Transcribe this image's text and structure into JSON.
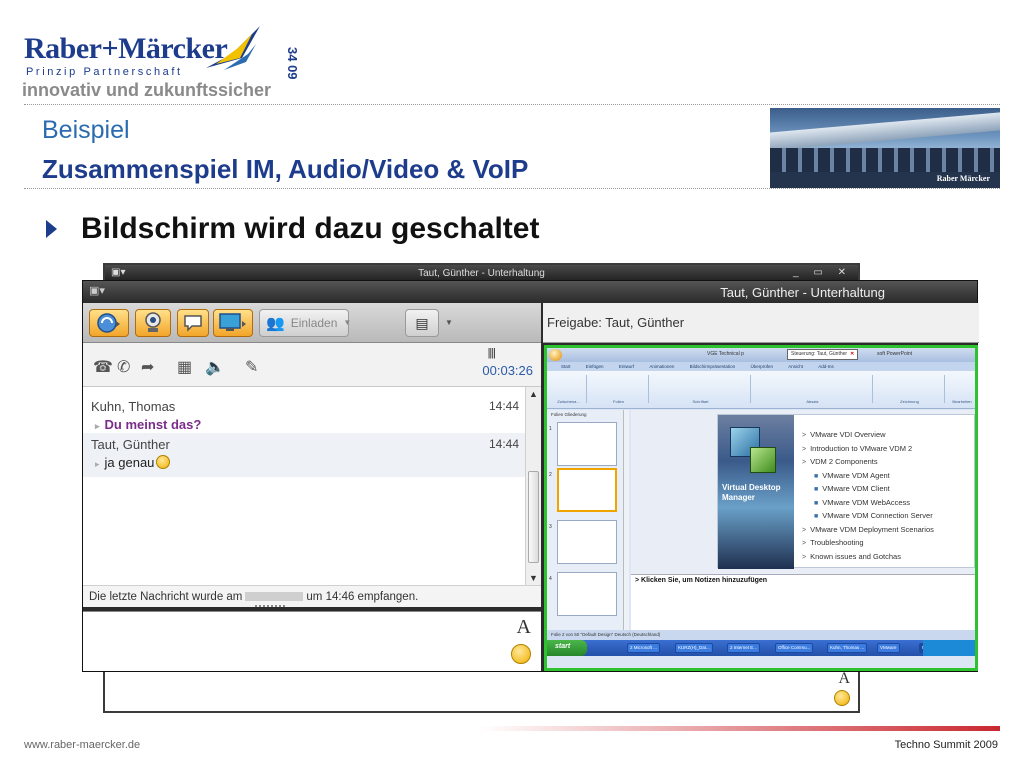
{
  "logo": {
    "brand": "Raber+Märcker",
    "subtitle": "Prinzip Partnerschaft",
    "tagline": "innovativ und zukunftssicher",
    "years": "34 09"
  },
  "slide": {
    "kicker": "Beispiel",
    "title": "Zusammenspiel IM, Audio/Video & VoIP",
    "bullet": "Bildschirm wird dazu geschaltet"
  },
  "building": {
    "sign": "Raber Märcker"
  },
  "back_window": {
    "title": "Taut, Günther - Unterhaltung",
    "controls": "_ ▭ ✕",
    "font_button": "A"
  },
  "communicator": {
    "title": "Taut, Günther - Unterhaltung",
    "toolbar": {
      "invite_label": "Einladen"
    },
    "timer": "00:03:26",
    "messages": [
      {
        "sender": "Kuhn, Thomas",
        "time": "14:44",
        "text": "Du meinst das?"
      },
      {
        "sender": "Taut, Günther",
        "time": "14:44",
        "text": "ja genau"
      }
    ],
    "status": {
      "prefix": "Die letzte Nachricht wurde am",
      "suffix": "um 14:46 empfangen."
    },
    "font_button": "A"
  },
  "share": {
    "title": "Freigabe: Taut, Günther",
    "app_title": "VGE Technical p",
    "control_badge": "Steuerung: Taut, Günther",
    "app_suffix": "soft PowerPoint",
    "tabs": [
      "Start",
      "Einfügen",
      "Entwurf",
      "Animationen",
      "Bildschirmpräsentation",
      "Überprüfen",
      "Ansicht",
      "Add-Ins"
    ],
    "ribbon_groups": [
      "Zwischena...",
      "Folien",
      "Schriftart",
      "Absatz",
      "Zeichnung",
      "Bearbeiten"
    ],
    "slide_tabs": "Folien   Gliederung",
    "slide_art_caption": "Virtual Desktop Manager",
    "bullets": [
      {
        "text": "VMware VDI Overview",
        "level": 1
      },
      {
        "text": "Introduction to VMware VDM 2",
        "level": 1
      },
      {
        "text": "VDM 2 Components",
        "level": 1
      },
      {
        "text": "VMware VDM Agent",
        "level": 2
      },
      {
        "text": "VMware VDM Client",
        "level": 2
      },
      {
        "text": "VMware VDM WebAccess",
        "level": 2
      },
      {
        "text": "VMware VDM Connection Server",
        "level": 2
      },
      {
        "text": "VMware VDM Deployment Scenarios",
        "level": 1
      },
      {
        "text": "Troubleshooting",
        "level": 1
      },
      {
        "text": "Known issues and Gotchas",
        "level": 1
      }
    ],
    "notes_placeholder": "Klicken Sie, um Notizen hinzuzufügen",
    "status_bar": "Folie 2 von 50   \"Default Design\"   Deutsch (Deutschland)",
    "taskbar": {
      "start": "start",
      "tasks": [
        "2 Microsoft ...",
        "KURZ(H)_Dat...",
        "2 Internet E...",
        "Office Commu...",
        "Kuhn, Thomas ...",
        "VMware",
        "Microsoft Pow..."
      ]
    }
  },
  "footer": {
    "website": "www.raber-maercker.de",
    "event": "Techno Summit 2009"
  },
  "colors": {
    "brand_blue": "#1e3c8c",
    "accent_red": "#c9282f",
    "share_border": "#2fc22f"
  }
}
